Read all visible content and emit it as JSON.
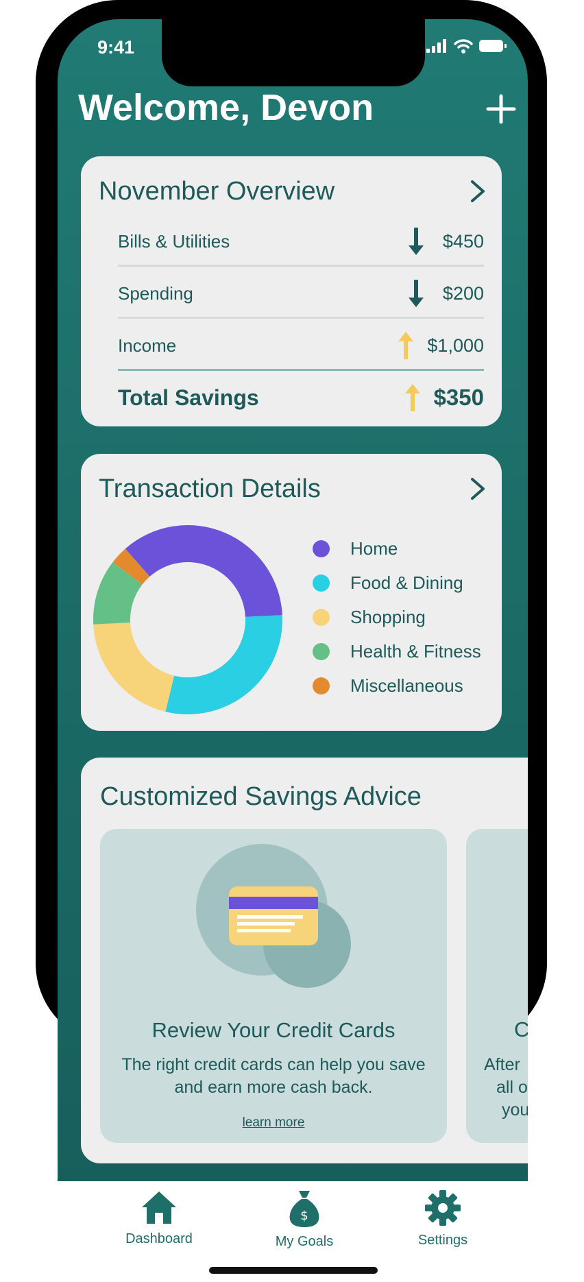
{
  "status": {
    "time": "9:41"
  },
  "header": {
    "welcome": "Welcome, Devon"
  },
  "colors": {
    "teal": "#217a74",
    "dark_teal": "#1e5a5a",
    "up": "#f7c85a"
  },
  "overview": {
    "title": "November Overview",
    "rows": [
      {
        "label": "Bills & Utilities",
        "amount": "$450",
        "direction": "down"
      },
      {
        "label": "Spending",
        "amount": "$200",
        "direction": "down"
      },
      {
        "label": "Income",
        "amount": "$1,000",
        "direction": "up"
      }
    ],
    "total": {
      "label": "Total Savings",
      "amount": "$350",
      "direction": "up"
    }
  },
  "transactions": {
    "title": "Transaction Details",
    "legend": [
      {
        "label": "Home",
        "color": "#6c52d9"
      },
      {
        "label": "Food & Dining",
        "color": "#2acfe3"
      },
      {
        "label": "Shopping",
        "color": "#f7d37a"
      },
      {
        "label": "Health & Fitness",
        "color": "#64c087"
      },
      {
        "label": "Miscellaneous",
        "color": "#e38a2e"
      }
    ]
  },
  "chart_data": {
    "type": "pie",
    "categories": [
      "Home",
      "Food & Dining",
      "Shopping",
      "Health & Fitness",
      "Miscellaneous"
    ],
    "values": [
      35,
      29,
      20,
      11,
      3
    ],
    "colors": [
      "#6c52d9",
      "#2acfe3",
      "#f7d37a",
      "#64c087",
      "#e38a2e"
    ],
    "donut": true
  },
  "advice": {
    "title": "Customized Savings Advice",
    "cards": [
      {
        "title": "Review Your Credit Cards",
        "body_line1": "The right credit cards can help you save",
        "body_line2": "and earn more cash back.",
        "link": "learn more"
      }
    ],
    "peek": {
      "title_fragment": "C",
      "line1": "After",
      "line2": "all o",
      "line3": "you"
    }
  },
  "tabbar": {
    "tabs": [
      {
        "label": "Dashboard",
        "icon": "home-icon"
      },
      {
        "label": "My Goals",
        "icon": "money-bag-icon"
      },
      {
        "label": "Settings",
        "icon": "gear-icon"
      }
    ]
  }
}
